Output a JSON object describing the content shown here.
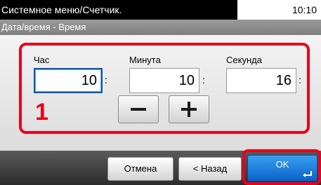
{
  "titlebar": {
    "title": "Системное меню/Счетчик.",
    "time": "10:10"
  },
  "subtitle": "Дата/время - Время",
  "fields": [
    {
      "label": "Час",
      "value": "10",
      "active": true
    },
    {
      "label": "Минута",
      "value": "10",
      "active": false
    },
    {
      "label": "Секунда",
      "value": "16",
      "active": false
    }
  ],
  "colon": ":",
  "step_number": "1",
  "buttons": {
    "minus_icon": "minus-icon",
    "plus_icon": "plus-icon",
    "cancel_label": "Отмена",
    "back_label": "< Назад",
    "ok_label": "OK"
  },
  "colors": {
    "highlight_red": "#e8001c",
    "ok_blue": "#0a62c8",
    "active_border": "#0a58b0"
  }
}
